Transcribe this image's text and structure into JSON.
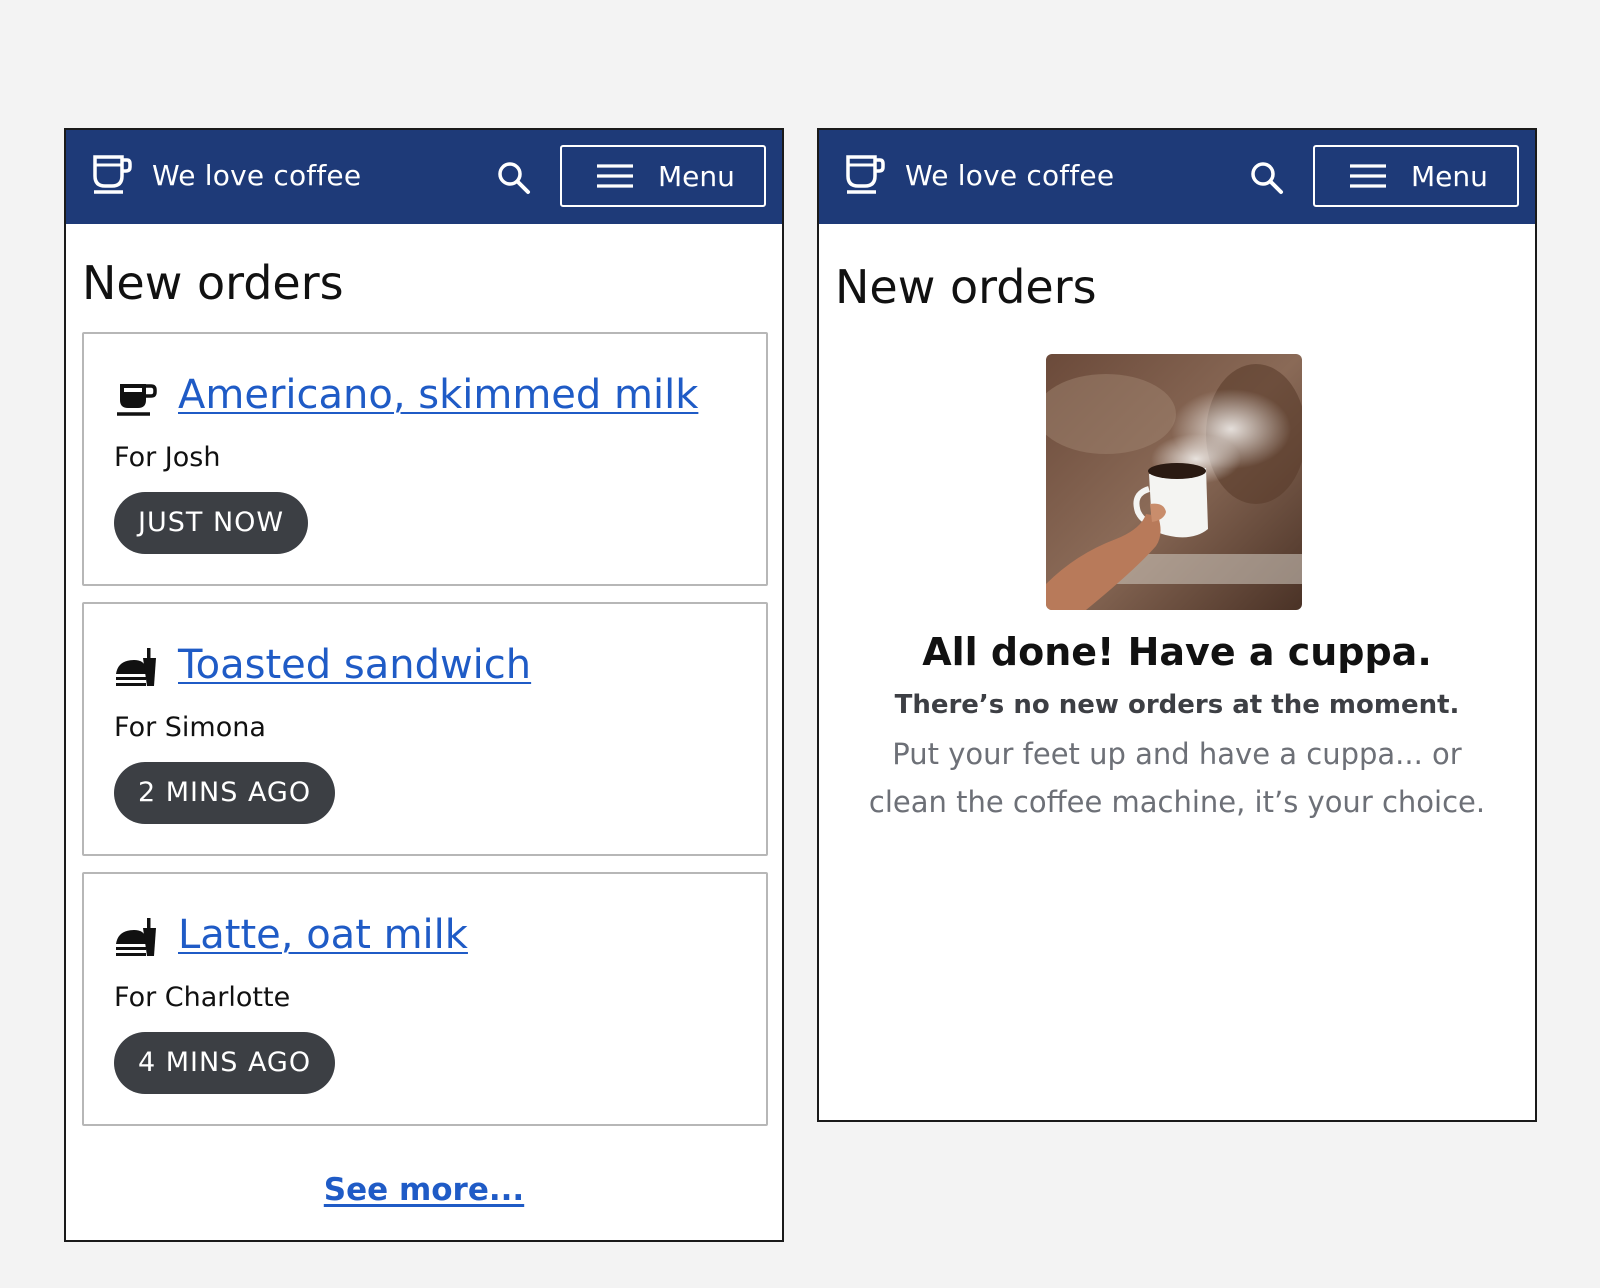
{
  "app": {
    "title": "We love coffee",
    "menu_label": "Menu",
    "brand_color": "#1e3a78",
    "link_color": "#1f5bc6",
    "badge_color": "#3c3f44"
  },
  "orders_screen": {
    "page_title": "New orders",
    "orders": [
      {
        "icon": "coffee-cup-icon",
        "title": "Americano, skimmed milk",
        "for": "For Josh",
        "time": "JUST NOW"
      },
      {
        "icon": "food-icon",
        "title": "Toasted sandwich",
        "for": "For Simona",
        "time": "2 MINS AGO"
      },
      {
        "icon": "food-icon",
        "title": "Latte, oat milk",
        "for": "For Charlotte",
        "time": "4 MINS AGO"
      }
    ],
    "see_more": "See more..."
  },
  "empty_screen": {
    "page_title": "New orders",
    "heading": "All done! Have a cuppa.",
    "subheading": "There’s no new orders at the moment.",
    "body": "Put your feet up and have a cuppa... or clean the coffee machine, it’s your choice.",
    "image": "hand-holding-steaming-coffee-cup"
  }
}
